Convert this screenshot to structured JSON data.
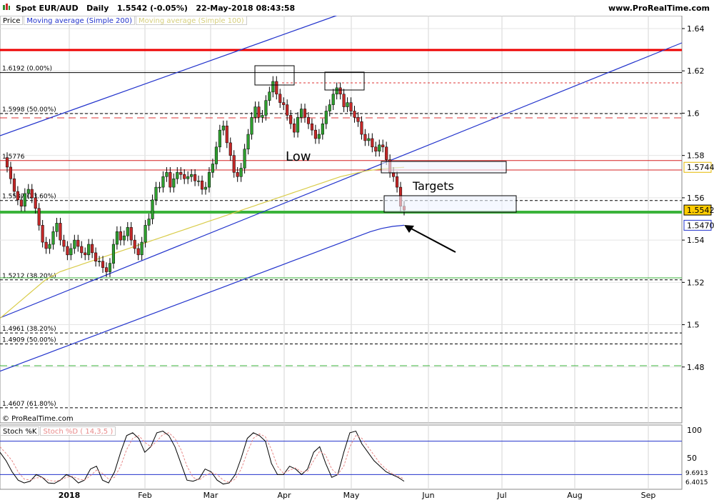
{
  "header": {
    "title": "Spot EUR/AUD   Daily   1.5542 (-0.05%)   22-May-2018 08:43:58",
    "site": "www.ProRealTime.com"
  },
  "legend": {
    "price": "Price",
    "ma200": "Moving average (Simple 200)",
    "ma100": "Moving average (Simple 100)"
  },
  "copyright": "© ProRealTime.com",
  "annotations": {
    "low": "Low",
    "targets": "Targets"
  },
  "price_labels": {
    "ma100_value": "1.5744",
    "last_price": "1.5542",
    "ma200_value": "1.5470",
    "ma100_color": "#e6b800",
    "last_color": "#ffcc00",
    "ma200_color": "#2233cc"
  },
  "levels": [
    {
      "label": "1.6192 (0.00%)",
      "value": 1.6192,
      "style": "solid-black"
    },
    {
      "label": "1.5998 (50.00%)",
      "value": 1.5998,
      "style": "dashed-black"
    },
    {
      "label": "1.5776",
      "value": 1.5776,
      "style": "solid-red"
    },
    {
      "label": "1.5587 (23.60%)",
      "value": 1.5587,
      "style": "dashed-black"
    },
    {
      "label": "1.5212 (38.20%)",
      "value": 1.5212,
      "style": "dashed-black"
    },
    {
      "label": "1.4961 (38.20%)",
      "value": 1.4961,
      "style": "dashed-black"
    },
    {
      "label": "1.4909 (50.00%)",
      "value": 1.4909,
      "style": "dashed-black"
    },
    {
      "label": "1.4607 (61.80%)",
      "value": 1.4607,
      "style": "dashed-black"
    }
  ],
  "stoch": {
    "label_k": "Stoch %K",
    "label_d": "Stoch %D ( 14,3,5 )",
    "axis_100": "100",
    "axis_50": "50",
    "val_d": "9.6913",
    "val_k": "6.4015"
  },
  "chart_data": [
    {
      "type": "candlestick",
      "title": "Spot EUR/AUD Daily",
      "x_labels": [
        "2018",
        "Feb",
        "Mar",
        "Apr",
        "May",
        "Jun",
        "Jul",
        "Aug",
        "Sep"
      ],
      "y_ticks": [
        "1.48",
        "1.5",
        "1.52",
        "1.54",
        "1.56",
        "1.58",
        "1.6",
        "1.62",
        "1.64"
      ],
      "ylim": [
        1.458,
        1.648
      ],
      "close_series": [
        1.5745,
        1.569,
        1.563,
        1.559,
        1.556,
        1.562,
        1.564,
        1.56,
        1.555,
        1.547,
        1.539,
        1.536,
        1.538,
        1.544,
        1.548,
        1.54,
        1.537,
        1.533,
        1.536,
        1.54,
        1.537,
        1.534,
        1.533,
        1.538,
        1.534,
        1.53,
        1.53,
        1.527,
        1.525,
        1.529,
        1.538,
        1.544,
        1.54,
        1.542,
        1.546,
        1.54,
        1.536,
        1.533,
        1.539,
        1.547,
        1.55,
        1.559,
        1.565,
        1.565,
        1.57,
        1.572,
        1.565,
        1.569,
        1.572,
        1.571,
        1.569,
        1.57,
        1.571,
        1.568,
        1.568,
        1.564,
        1.565,
        1.572,
        1.576,
        1.584,
        1.592,
        1.594,
        1.586,
        1.58,
        1.572,
        1.57,
        1.574,
        1.583,
        1.59,
        1.598,
        1.603,
        1.598,
        1.599,
        1.606,
        1.61,
        1.615,
        1.609,
        1.605,
        1.604,
        1.599,
        1.595,
        1.591,
        1.598,
        1.602,
        1.598,
        1.595,
        1.592,
        1.588,
        1.59,
        1.595,
        1.601,
        1.604,
        1.609,
        1.612,
        1.609,
        1.603,
        1.605,
        1.601,
        1.598,
        1.596,
        1.59,
        1.587,
        1.588,
        1.584,
        1.582,
        1.585,
        1.584,
        1.578,
        1.572,
        1.57,
        1.565,
        1.556,
        1.5542
      ],
      "ma100": [
        1.503,
        1.5045,
        1.506,
        1.5075,
        1.509,
        1.5105,
        1.512,
        1.5135,
        1.515,
        1.5165,
        1.518,
        1.5195,
        1.521,
        1.522,
        1.523,
        1.524,
        1.525,
        1.5256,
        1.5262,
        1.5268,
        1.5274,
        1.528,
        1.5286,
        1.5292,
        1.5298,
        1.5304,
        1.531,
        1.5316,
        1.5322,
        1.5328,
        1.5334,
        1.534,
        1.5346,
        1.5352,
        1.5358,
        1.5364,
        1.537,
        1.5376,
        1.5382,
        1.5388,
        1.5394,
        1.54,
        1.5406,
        1.5412,
        1.5418,
        1.5424,
        1.543,
        1.5436,
        1.5442,
        1.5448,
        1.5454,
        1.546,
        1.5466,
        1.5472,
        1.5478,
        1.5484,
        1.549,
        1.5496,
        1.5502,
        1.5508,
        1.5514,
        1.552,
        1.5526,
        1.5532,
        1.5538,
        1.5544,
        1.555,
        1.5556,
        1.5562,
        1.5568,
        1.5574,
        1.558,
        1.5586,
        1.5592,
        1.5598,
        1.5604,
        1.561,
        1.5616,
        1.5622,
        1.5628,
        1.5634,
        1.564,
        1.5646,
        1.5652,
        1.5658,
        1.5664,
        1.567,
        1.5676,
        1.5682,
        1.5688,
        1.5694,
        1.57,
        1.5704,
        1.5708,
        1.5712,
        1.5716,
        1.572,
        1.5724,
        1.5728,
        1.573,
        1.5732,
        1.5734,
        1.5736,
        1.5738,
        1.574,
        1.5741,
        1.5742,
        1.5743,
        1.5744
      ],
      "ma200": [
        1.478,
        1.48,
        1.482,
        1.484,
        1.486,
        1.488,
        1.49,
        1.492,
        1.494,
        1.496,
        1.498,
        1.5,
        1.502,
        1.504,
        1.506,
        1.508,
        1.51,
        1.512,
        1.514,
        1.516,
        1.518,
        1.52,
        1.522,
        1.524,
        1.526,
        1.528,
        1.53,
        1.532,
        1.534,
        1.536,
        1.538,
        1.54,
        1.542,
        1.544,
        1.5455,
        1.5465,
        1.547
      ]
    },
    {
      "type": "line",
      "title": "Stoch %K / Stoch %D (14,3,5)",
      "ylim": [
        0,
        100
      ],
      "series": [
        {
          "name": "Stoch %K",
          "values": [
            60,
            45,
            25,
            10,
            5,
            8,
            20,
            15,
            5,
            4,
            10,
            20,
            15,
            5,
            10,
            30,
            35,
            10,
            5,
            25,
            60,
            90,
            95,
            85,
            60,
            70,
            95,
            98,
            90,
            70,
            40,
            10,
            8,
            12,
            30,
            25,
            10,
            3,
            5,
            20,
            50,
            85,
            95,
            90,
            80,
            40,
            20,
            20,
            35,
            30,
            20,
            30,
            60,
            70,
            40,
            15,
            20,
            60,
            95,
            98,
            75,
            60,
            45,
            35,
            25,
            20,
            15,
            8
          ]
        },
        {
          "name": "Stoch %D",
          "values": [
            70,
            58,
            45,
            25,
            12,
            10,
            14,
            15,
            10,
            8,
            10,
            15,
            17,
            12,
            10,
            18,
            28,
            22,
            12,
            15,
            35,
            65,
            85,
            90,
            78,
            70,
            80,
            92,
            95,
            85,
            65,
            35,
            15,
            10,
            18,
            24,
            20,
            10,
            6,
            12,
            30,
            60,
            85,
            93,
            88,
            65,
            35,
            22,
            28,
            32,
            25,
            26,
            45,
            62,
            55,
            30,
            20,
            35,
            70,
            90,
            85,
            70,
            55,
            40,
            30,
            22,
            17,
            12
          ]
        }
      ]
    }
  ]
}
